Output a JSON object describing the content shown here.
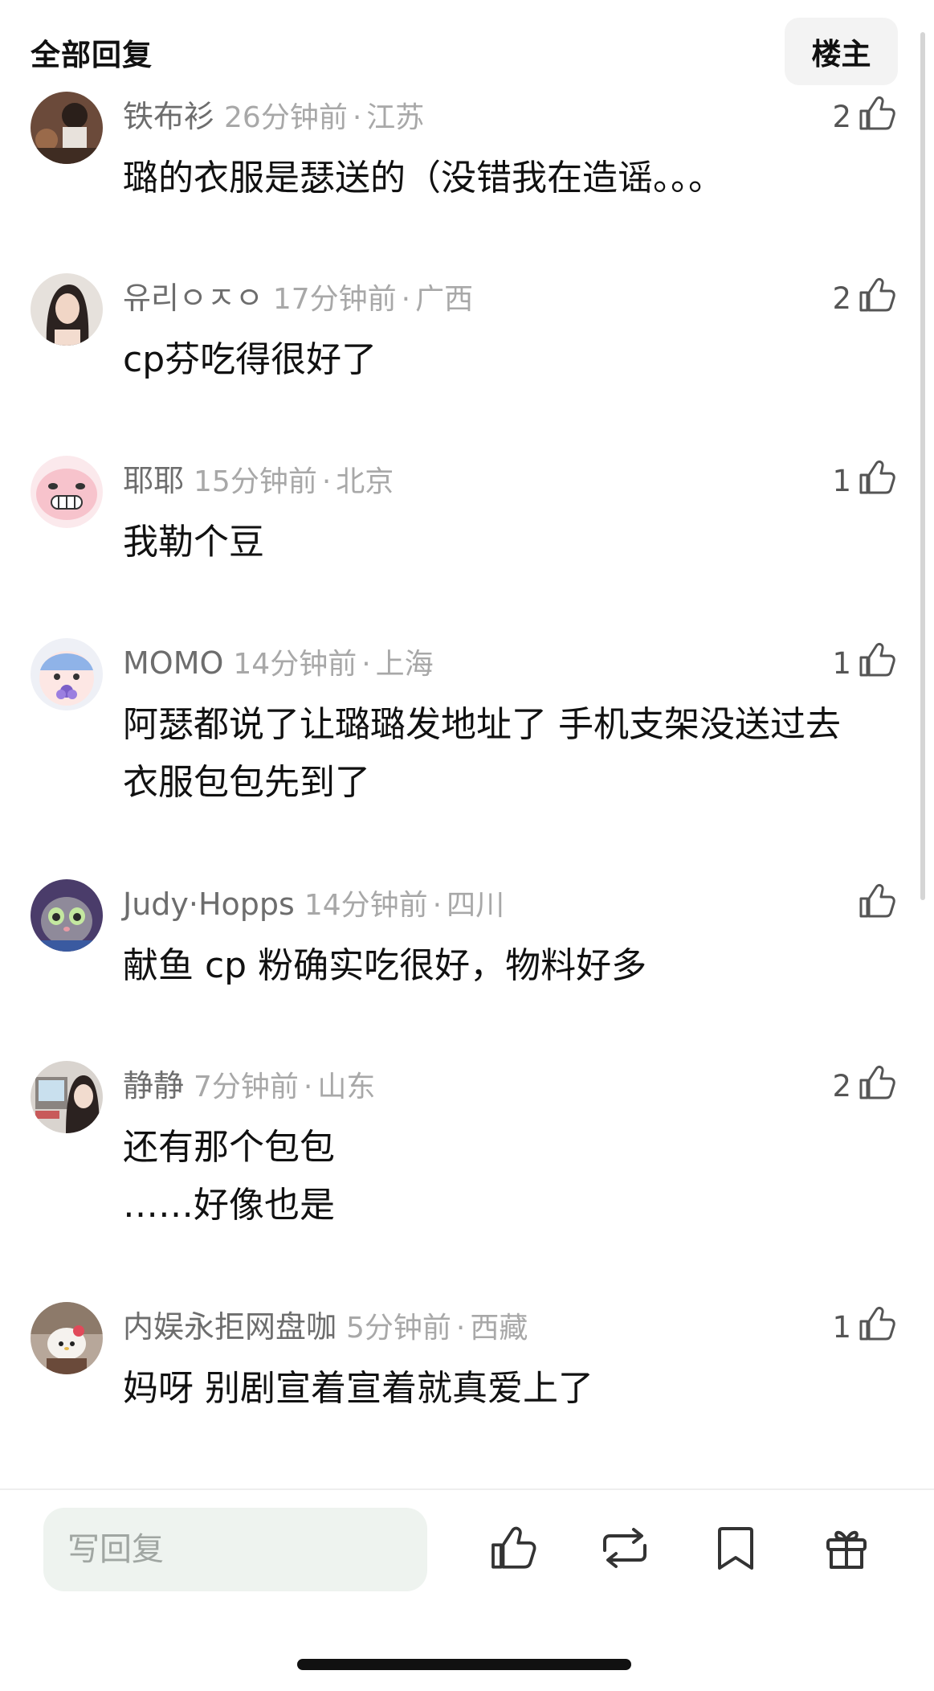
{
  "header": {
    "title": "全部回复",
    "owner_button_label": "楼主"
  },
  "comments": [
    {
      "name": "铁布衫",
      "time": "26分钟前",
      "location": "江苏",
      "likes": "2",
      "text": "璐的衣服是瑟送的（没错我在造谣。。。"
    },
    {
      "name": "유리ㅇㅈㅇ",
      "time": "17分钟前",
      "location": "广西",
      "likes": "2",
      "text": "cp芬吃得很好了"
    },
    {
      "name": "耶耶",
      "time": "15分钟前",
      "location": "北京",
      "likes": "1",
      "text": "我勒个豆"
    },
    {
      "name": "MOMO",
      "time": "14分钟前",
      "location": "上海",
      "likes": "1",
      "text": "阿瑟都说了让璐璐发地址了 手机支架没送过去 衣服包包先到了"
    },
    {
      "name": "Judy·Hopps",
      "time": "14分钟前",
      "location": "四川",
      "likes": "",
      "text": "献鱼 cp 粉确实吃很好，物料好多"
    },
    {
      "name": "静静",
      "time": "7分钟前",
      "location": "山东",
      "likes": "2",
      "text": "还有那个包包\n……好像也是"
    },
    {
      "name": "内娱永拒网盘咖",
      "time": "5分钟前",
      "location": "西藏",
      "likes": "1",
      "text": "妈呀 别剧宣着宣着就真爱上了"
    }
  ],
  "bottom_bar": {
    "reply_placeholder": "写回复"
  },
  "colors": {
    "name": "#6d6d6d",
    "meta": "#a8a8a8",
    "text": "#111111",
    "input_bg": "#eef3ef"
  },
  "icons": {
    "like": "thumbs-up-icon",
    "repost": "repost-icon",
    "bookmark": "bookmark-icon",
    "gift": "gift-icon"
  }
}
